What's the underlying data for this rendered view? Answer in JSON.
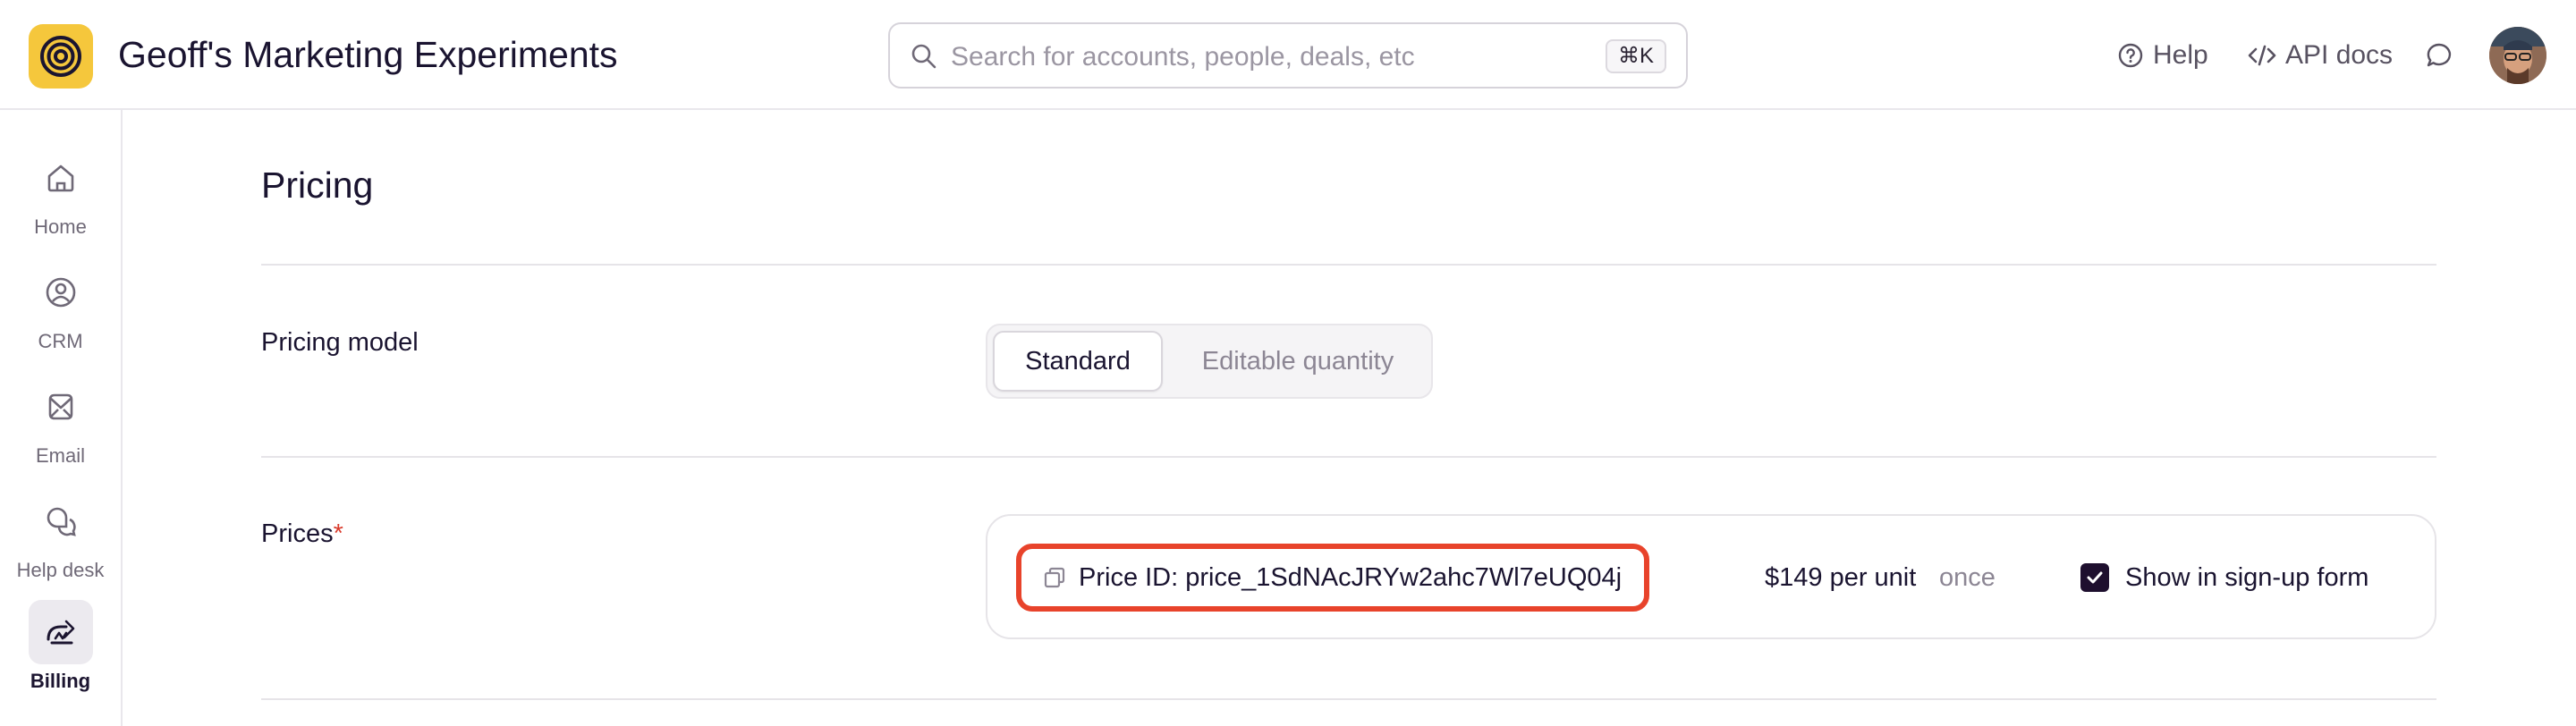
{
  "app": {
    "title": "Geoff's Marketing Experiments",
    "logo_icon": "spiral-logo",
    "accent": "#f5c73c"
  },
  "search": {
    "placeholder": "Search for accounts, people, deals, etc",
    "shortcut": "⌘K"
  },
  "header_links": {
    "help": "Help",
    "api_docs": "API docs"
  },
  "sidebar": {
    "items": [
      {
        "label": "Home",
        "icon": "home-icon"
      },
      {
        "label": "CRM",
        "icon": "crm-icon"
      },
      {
        "label": "Email",
        "icon": "email-icon"
      },
      {
        "label": "Help desk",
        "icon": "help-desk-icon"
      },
      {
        "label": "Billing",
        "icon": "billing-icon",
        "active": true
      }
    ]
  },
  "main": {
    "section_title": "Pricing",
    "pricing_model": {
      "label": "Pricing model",
      "options": [
        "Standard",
        "Editable quantity"
      ],
      "selected": "Standard"
    },
    "prices": {
      "label": "Prices",
      "required_mark": "*",
      "items": [
        {
          "price_id": "Price ID: price_1SdNAcJRYw2ahc7Wl7eUQ04j",
          "amount": "$149 per unit",
          "frequency": "once",
          "show_in_signup_label": "Show in sign-up form",
          "show_in_signup": true
        }
      ]
    }
  },
  "colors": {
    "highlight": "#e8432b",
    "required": "#d93a2b",
    "checkbox": "#1e0f2e"
  }
}
